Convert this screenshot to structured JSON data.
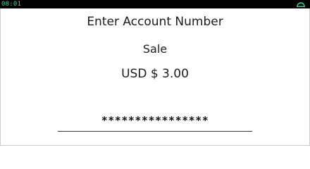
{
  "status_bar": {
    "time": "08:01",
    "connection_icon": "connection-status-icon",
    "accent_color": "#2fd3a4"
  },
  "screen": {
    "prompt": "Enter Account Number",
    "transaction_type": "Sale",
    "amount": "USD $ 3.00"
  },
  "account_input": {
    "value": "****************"
  }
}
